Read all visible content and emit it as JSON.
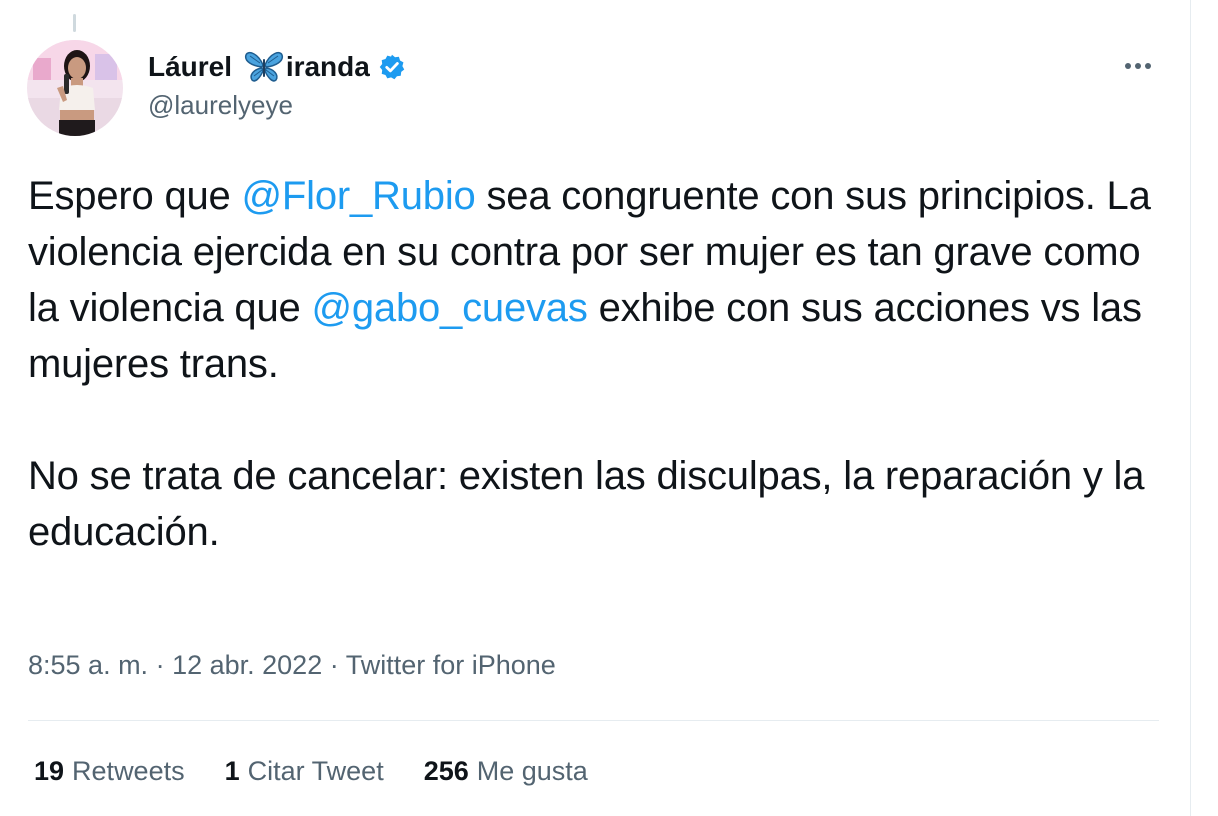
{
  "author": {
    "name_before": "Láurel ",
    "name_after": "iranda",
    "handle": "@laurelyeye",
    "verified": true,
    "icons": {
      "name_emoji": "butterfly-icon",
      "badge": "verified-badge-icon"
    }
  },
  "tweet": {
    "p1_a": "Espero que ",
    "mention1": "@Flor_Rubio",
    "p1_b": " sea congruente con sus principios. La violencia ejercida en su contra por ser mujer es tan grave como la violencia que ",
    "mention2": "@gabo_cuevas",
    "p1_c": " exhibe con sus acciones vs las mujeres trans.",
    "p2": "No se trata de cancelar: existen las disculpas, la reparación y la educación."
  },
  "meta": {
    "time": "8:55 a. m.",
    "separator": " · ",
    "date": "12 abr. 2022",
    "source": "Twitter for iPhone"
  },
  "stats": [
    {
      "count": "19",
      "label": "Retweets"
    },
    {
      "count": "1",
      "label": "Citar Tweet"
    },
    {
      "count": "256",
      "label": "Me gusta"
    }
  ],
  "colors": {
    "link": "#1d9bf0",
    "text": "#0f1419",
    "secondary": "#536471",
    "border": "#e6ecf0"
  }
}
